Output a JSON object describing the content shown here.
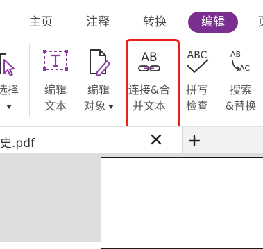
{
  "menu": {
    "tabs": [
      {
        "label": "主页"
      },
      {
        "label": "注释"
      },
      {
        "label": "转换"
      },
      {
        "label": "编辑"
      },
      {
        "label": "页"
      }
    ],
    "active_color": "#7a2f90"
  },
  "ribbon": {
    "tools": [
      {
        "line1": "选择",
        "icon": "select-cursor-icon"
      },
      {
        "line1": "编辑",
        "line2": "文本",
        "icon": "edit-text-icon"
      },
      {
        "line1": "编辑",
        "line2": "对象",
        "icon": "edit-object-icon"
      },
      {
        "line1": "连接&合",
        "line2": "并文本",
        "icon": "link-merge-text-icon"
      },
      {
        "line1": "拼写",
        "line2": "检查",
        "icon": "spell-check-icon"
      },
      {
        "line1": "搜索",
        "line2": "&替换",
        "icon": "search-replace-icon"
      }
    ],
    "icon_text": {
      "ab": "AB",
      "abc": "ABC",
      "ab_small": "AB",
      "ac_small": "AC"
    },
    "highlight_color": "#e8211a"
  },
  "tabs": {
    "document_tab_label": "史.pdf"
  }
}
